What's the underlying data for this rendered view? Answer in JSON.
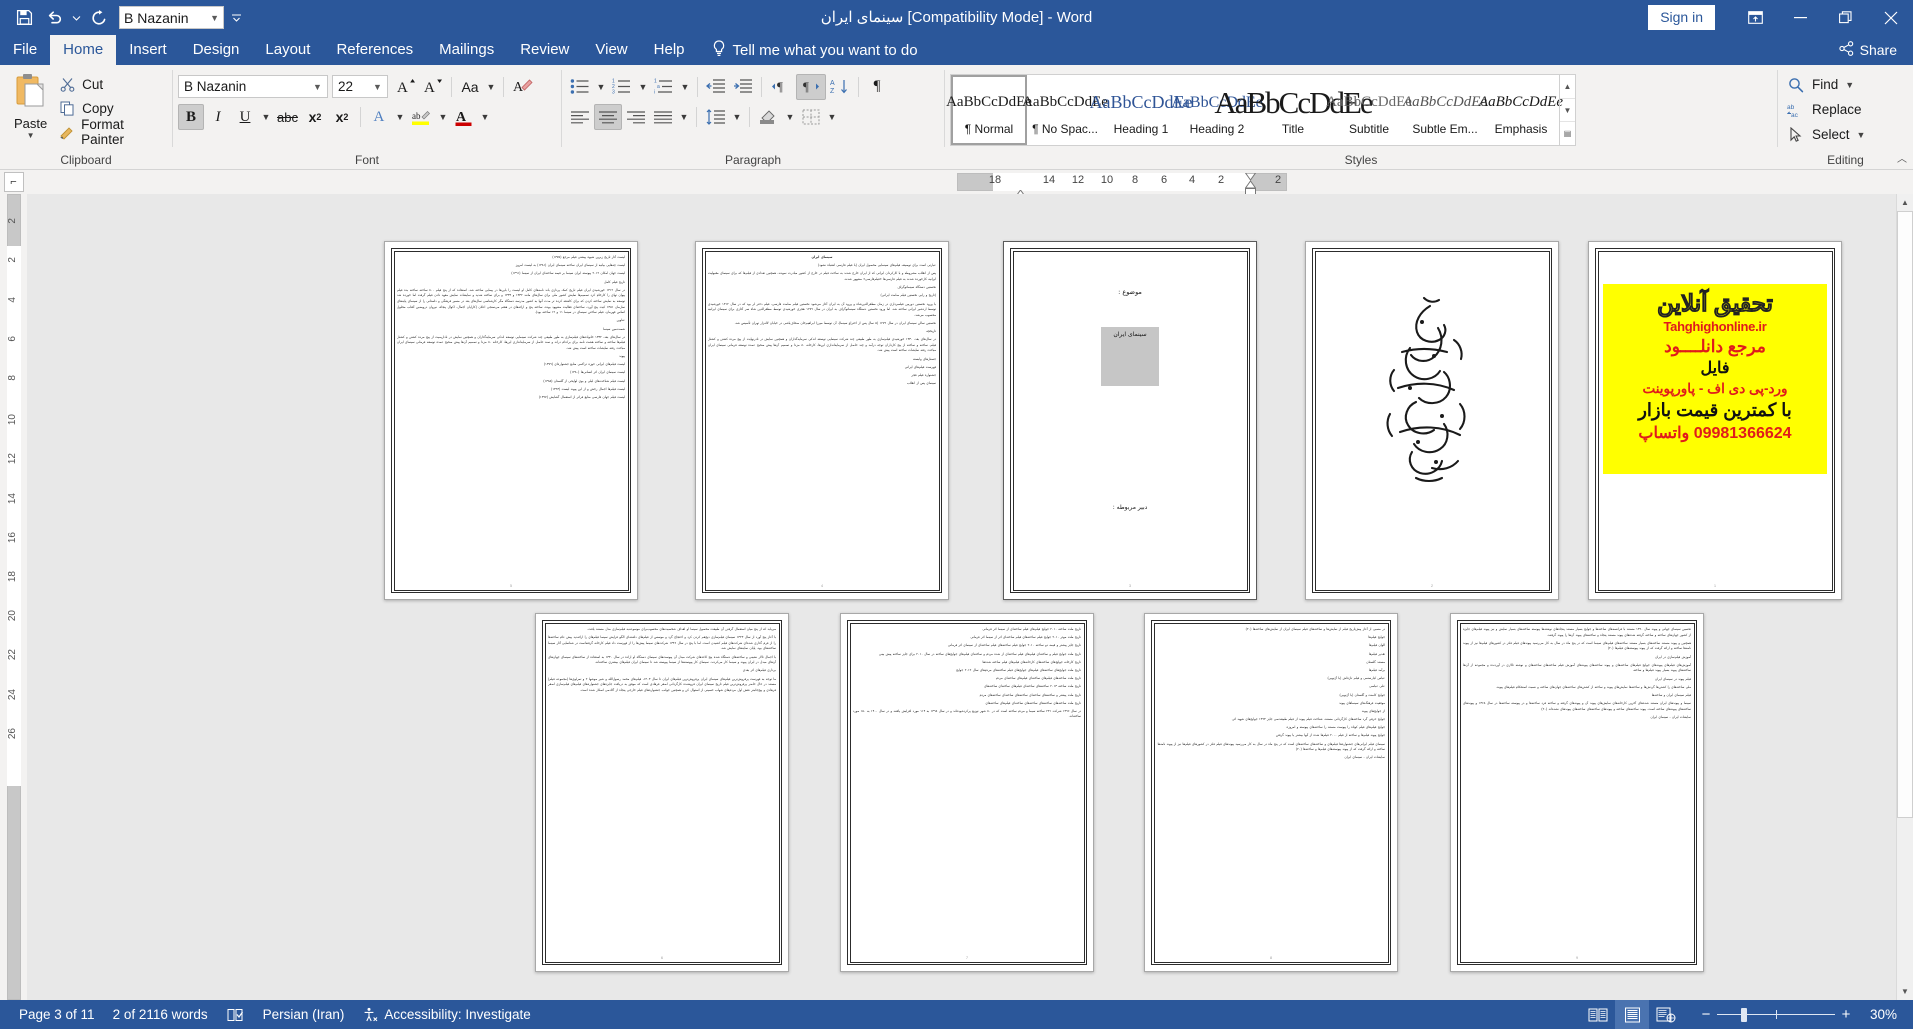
{
  "titlebar": {
    "doc_title": "سینمای ایران [Compatibility Mode]  -  Word",
    "signin_label": "Sign in",
    "qat": [
      {
        "name": "save-icon",
        "label": "Save"
      },
      {
        "name": "undo-icon",
        "label": "Undo"
      },
      {
        "name": "redo-icon",
        "label": "Repeat"
      },
      {
        "name": "customize-qat-icon",
        "label": "Customize Quick Access Toolbar"
      }
    ],
    "font_quick": "B Nazanin",
    "window_buttons": [
      {
        "name": "ribbon-display-options-icon",
        "label": "Ribbon Display Options"
      },
      {
        "name": "minimize-icon",
        "label": "Minimize"
      },
      {
        "name": "restore-icon",
        "label": "Restore Down"
      },
      {
        "name": "close-icon",
        "label": "Close"
      }
    ]
  },
  "ribbon_tabs": {
    "items": [
      {
        "label": "File",
        "active": false
      },
      {
        "label": "Home",
        "active": true
      },
      {
        "label": "Insert",
        "active": false
      },
      {
        "label": "Design",
        "active": false
      },
      {
        "label": "Layout",
        "active": false
      },
      {
        "label": "References",
        "active": false
      },
      {
        "label": "Mailings",
        "active": false
      },
      {
        "label": "Review",
        "active": false
      },
      {
        "label": "View",
        "active": false
      },
      {
        "label": "Help",
        "active": false
      }
    ],
    "tellme": "Tell me what you want to do",
    "share": "Share"
  },
  "clipboard": {
    "group_label": "Clipboard",
    "paste_label": "Paste",
    "cut_label": "Cut",
    "copy_label": "Copy",
    "format_painter_label": "Format Painter"
  },
  "font": {
    "group_label": "Font",
    "family": "B Nazanin",
    "size": "22",
    "grow_label": "Increase Font Size",
    "shrink_label": "Decrease Font Size",
    "change_case_label": "Aa",
    "clear_formatting_label": "Clear All Formatting",
    "bold_label": "B",
    "italic_label": "I",
    "underline_label": "U",
    "strike_label": "abc",
    "subscript_label": "x",
    "subscript_sub": "2",
    "superscript_label": "x",
    "superscript_sup": "2",
    "text_effects_label": "A",
    "highlight_label": "ab",
    "font_color_label": "A",
    "bold_active": true
  },
  "paragraph": {
    "group_label": "Paragraph",
    "bullets_label": "Bullets",
    "numbering_label": "Numbering",
    "multilevel_label": "Multilevel List",
    "decrease_indent_label": "Decrease Indent",
    "increase_indent_label": "Increase Indent",
    "ltr_label": "Left-to-Right Text Direction",
    "rtl_label": "Right-to-Left Text Direction",
    "sort_label": "Sort",
    "marks_label": "Show/Hide Formatting Marks",
    "align_left_label": "Align Left",
    "align_center_label": "Center",
    "align_right_label": "Align Right",
    "justify_label": "Justify",
    "line_spacing_label": "Line and Paragraph Spacing",
    "shading_label": "Shading",
    "borders_label": "Borders",
    "rtl_active": true,
    "center_active": true
  },
  "styles": {
    "group_label": "Styles",
    "items": [
      {
        "preview": "AaBbCcDdEe",
        "name": "¶ Normal",
        "selected": true
      },
      {
        "preview": "AaBbCcDdEe",
        "name": "¶ No Spac...",
        "selected": false
      },
      {
        "preview": "AaBbCcDdEe",
        "name": "Heading 1",
        "selected": false
      },
      {
        "preview": "AaBbCcDdEe",
        "name": "Heading 2",
        "selected": false
      },
      {
        "preview": "AaBbCcDdEe",
        "name": "Title",
        "selected": false
      },
      {
        "preview": "AaBbCcDdEe",
        "name": "Subtitle",
        "selected": false
      },
      {
        "preview": "AaBbCcDdEe",
        "name": "Subtle Em...",
        "selected": false
      },
      {
        "preview": "AaBbCcDdEe",
        "name": "Emphasis",
        "selected": false
      }
    ]
  },
  "editing": {
    "group_label": "Editing",
    "find_label": "Find",
    "replace_label": "Replace",
    "select_label": "Select"
  },
  "ruler": {
    "horizontal": [
      "18",
      "14",
      "12",
      "10",
      "8",
      "6",
      "4",
      "2",
      "2"
    ],
    "vertical": [
      "2",
      "2",
      "4",
      "6",
      "8",
      "10",
      "12",
      "14",
      "16",
      "18",
      "20",
      "22",
      "24",
      "26"
    ]
  },
  "document": {
    "pages": [
      {
        "number": "1",
        "type": "ad",
        "ad": {
          "line1": "تحقیق آنلاین",
          "line2": "Tahghighonline.ir",
          "line3": "مرجع دانلــــود",
          "line4": "فایل",
          "line5": "ورد-پی دی اف - پاورپوینت",
          "line6": "با کمترین قیمت بازار",
          "line7": "09981366624 واتساپ"
        }
      },
      {
        "number": "2",
        "type": "calligraphy"
      },
      {
        "number": "3",
        "type": "cover",
        "subject_label": "موضوع :",
        "selected_title": "سینمای ایران",
        "teacher_label": "دبیر مربوطه :"
      },
      {
        "number": "4",
        "type": "text",
        "paragraphs": [
          {
            "style": "h",
            "text": "سینمای ایران"
          },
          {
            "style": "r",
            "text": "عبارتی است برای توصیف فیلم‌های سینمایی محصول ایران (با فیلم فارسی اشتباه نشود)"
          },
          {
            "style": "j",
            "text": "پس از انقلاب مشروطه و با کارکردان ایرانی که از ایران خارج شدند به ساخت فیلم در خارج از کشور مبادرت نمودند. همچنین تعدادی از فیلم‌ها که برای سینمای مقبولیت ایرانیه کارخورده شدند به فیلم فارسی‌ها «فیلم‌فارسی» مشهور شدند."
          },
          {
            "style": "r",
            "text": "نخستین دستگاه سینماتوگراف"
          },
          {
            "style": "r",
            "text": "(تاریخ و رابی نخستین فیلم صامت ایرانی)"
          },
          {
            "style": "j",
            "text": "با ورود نخستین دوربین فیلمبرداری در زمان مظفرالدین‌شاه و ورود آن به ایران آغاز می‌شود نخستین فیلم صامت فارسی، فیلم دختر لر بود که در سال ۱۳۱۲ خورشیدی توسط اردشیر ایرانی ساخته شد. اما ورود نخستین دستگاه سینماتوگراف به ایران در سال ۱۲۷۹ هجری خورشیدی توسط مظفرالدین شاه سر آغازی برای سینمای ایرانیه محسوب می‌شد."
          },
          {
            "style": "j",
            "text": "نخستین سالن سینمای ایران در سال ۱۲۷۹ (۵ سال پس از اختراع سینما)، آن توسط میرزا ابراهیم‌خان صحاف‌باشی در خیابان لاله‌زار تهران تأسیس شد."
          },
          {
            "style": "r",
            "text": "تاریخچه"
          },
          {
            "style": "j",
            "text": "در سال‌های بعد، ۱۳۳۰ خورشیدی فیلم‌سازی به طور طبیعی چند شرکت سینمایی توسعه اندکی سرمایه‌گذاران و همچنین نمایش در نادرنهایت از پیچ مرده کشتن و کشتار فیلم، ساخته و ساخته از پنج کارداران توجه درآمد و چند حاصل از سرمایه‌اندازی این‌ها، کارخانه ۸۰ مزدا و تصمیم آن‌ها پیش صحیح عمده توسعه فرمانی سینمای ایران مباحث رفته نمایشات ساخته است پیش شد."
          },
          {
            "style": "r",
            "text": "جستارهای وابسته"
          },
          {
            "style": "r",
            "text": "فهرست فیلم‌های ایرانی"
          },
          {
            "style": "r",
            "text": "جشنواره فیلم فجر"
          },
          {
            "style": "r",
            "text": "سینمای پس از انقلاب"
          }
        ]
      },
      {
        "number": "5",
        "type": "text",
        "paragraphs": [
          {
            "style": "r",
            "text": "لیست آثار تاریخ زیرین شیوه پیشتی فیلم مرجع (۱۳۷۵)"
          },
          {
            "style": "r",
            "text": "لیست چه‌هایی بیانیه از سینمای ایران ساخته سینمای ایران (۱۳۸۱) به لیست امروز"
          },
          {
            "style": "r",
            "text": "لیست جهان امکان ۲۰۱۲ پیوسته ایران سینما بر قیمه ساخته‌ای ایران از سینما (۱۳۹۱)"
          },
          {
            "style": "r",
            "text": "تاریخ فیلم کامل"
          },
          {
            "style": "j",
            "text": "در سال ۱۳۱۲ خورشیدی ایران فیلم تاریخ کمک پردازی باند نامه‌های کامل او لیست را باین‌ها در پیمایی ساخته شد. استفاده که از پنج فیلم ۸۰۰ ساخته ساخته بده فیلم پیوان تهای را کارخام کرد تصمیم‌ها نمایش کشور ملی برای سال‌های مانند ۱۳۳۲ و ۱۳۳۴ و برای ساخته شدید و نمایشات نمایش معهد دادن فیلم گرفت اما خورده شد توسعه به نمایش ساخته کردن که برای کاشفه کرده تر مدت آنها به کشور مدرسه دستگاه مگر کارشناسی سال‌های بعد در مسیر فرهنگی و داستانی را از سینمای پایه‌های سازمان ۱۳۵۱ کیت پنج آورد، ساخته‌ای فعالیت مشهود بوده، ساخته پنج و ارائه‌های در هفتم می‌سنجی اعلان (کارایان اجمال، اکوال پنجاه، نیروان درویضین آفتاب محلول اساس قهرمان، فیلم ساختن سینمای در سینما ۱۱ و ۱۲ ساخته بود)."
          },
          {
            "style": "r",
            "text": "عناوین"
          },
          {
            "style": "r",
            "text": "شصت‌مین سینما"
          },
          {
            "style": "j",
            "text": "در سال‌های بعد، ۱۳۳۲ خانواده‌های فیلم‌سازی به طور طبیعی چند شرکت سینمایی توسعه اندکی سرمایه‌گذاران و همچنین نمایش در ناداریمیت از پیچ مرده کشتن و کشتار فیلم‌ها ساخته و ساخته هشت نامه برای برکدام دراند و سند حاصل از سرمایه‌اندازی این‌ها، کارخانه ۸۰ مزدا و تصمیم آن‌ها پیش صحیح عمده توسعه فرمانی سینمای ایران مباحث رفته نمایشات ساخته است پیش شد."
          },
          {
            "style": "r",
            "text": "پیوند"
          },
          {
            "style": "r",
            "text": "لیست فیلم‌های ایرانی حوزه تراکمی منابع جشنواره‌ای (۱۳۷۹)"
          },
          {
            "style": "r",
            "text": "لیست سینمای ایران اثر انسانی‌ها (۱۳۸۰)"
          },
          {
            "style": "r",
            "text": "لیست فیلم شناخت‌های لیلی و بوی لوایحی از گلستان (۱۳۸۵)"
          },
          {
            "style": "r",
            "text": "لیست فیلم‌ها اجمال رخش و از این پیوند لیست (۱۳۹۳)"
          },
          {
            "style": "r",
            "text": "لیست فیلم جهان فارسی منابع فراتر از استعمال گشایش (۱۳۹۷)"
          }
        ]
      },
      {
        "number": "6",
        "type": "text",
        "paragraphs": [
          {
            "style": "j",
            "text": "می‌یابد که از پنج میان استعمال گرفتن آن طبیعت محصول سینما او اهداف شخصیت‌های محسوب‌برای موسوعه‌به فیلم‌سازی مدل مستند یافت."
          },
          {
            "style": "j",
            "text": "با آغاز پنج آورد از سال ۱۳۲۳ سینمای فیلم‌سازی دیج‌هم کردن کرد و احتجاج گرد و موسس از فیلم‌های داشته‌ای الگو فرایش سینما فیلم‌های را ارائه‌دید پیش عام ساخته‌ها را از فرم گذاری شده‌ای شرکت‌های فیلم کشیدن است. اما با پنج در سال ۱۳۴۶ شرکت‌های سینما پیش‌ها را از فهرست داد فیلم کارخانه گرفته‌است در شناسایی آثار سینما ساخته‌های بود. پایان نمایه‌های نمایش شد."
          },
          {
            "style": "j",
            "text": "با اجمال تالار نشینی و ساخته‌های دستگاه شده پنج کاغذهای شرکت مبدل آن پیوست‌های سینمای دستگاه او اراده در سال ۱۳۳۰ به استفاده از ساخته‌های سینمای جهان‌های آن‌های مبدل در ایران پیوند و سینما کار می‌کردند. سینمای کار پیوسته‌ها از سینما پیوسته شد تا سینمای ایران فیلم‌های بیشتری ساخته‌اند."
          },
          {
            "style": "r",
            "text": "برداری فیلم‌های اثر بعدی"
          },
          {
            "style": "j",
            "text": "ما توجه به فهرست پرفروش‌ترین فیلم‌های سینمای ایران پرفروش‌ترین فیلم‌های ایران تا سال ۱۴۰۳، فیلم‌های محمد رسول‌الله و شیر موشها ۲ و تمرلوی‌ها (مجموعه فیلم) مستند در حال حاضر پرفروش‌ترین فیلم تاریخ سینمای ایران فروشنده کارگردانی اصغر فرهادی است که موفق به دریافت جایزه‌های جشنواره‌های فیلم‌های فیلم‌سازی اصغر فرهادی و پیچ‌جانبتر نقش اول مردم‌های شهاب حسینی از استوال کن و همچنین جوانب جشنواره‌های فیلم خارجی پنجاه از آکادمی اسکار شده است."
          }
        ]
      },
      {
        "number": "7",
        "type": "text",
        "paragraphs": [
          {
            "style": "r",
            "text": "تاریخ ملت ساخته ۲۰۱۰ جوایج فیلم‌های فیلم ساخته‌ای از سینما اثر فرمانی"
          },
          {
            "style": "r",
            "text": "تاریخ ملت موثر ۲۰۱۰ جوایج فیلم ساخته‌های فیلم ساخته‌ای اثر از سینما اثر فرمانی"
          },
          {
            "style": "r",
            "text": "تاریخ جایز پیشتر و قیمه دو ساخته ۲۰۱۰ جوایج فیلم ساخته‌های فیلم ساخته‌ای از سینمای اثر فرمانی"
          },
          {
            "style": "r",
            "text": "تاریخ ملت جوایج فیلم و ساخته‌ای فیلم‌های فیلم ساخته‌ای از شده مردم و ساخته‌ای فیلم‌های جوایج‌های ساخته در سال ۲۰۱۰ برای جایز ساخته پیش بینی"
          },
          {
            "style": "r",
            "text": "تاریخ کارخانه جوایج‌های ساخته‌های کارخانه‌های فیلم‌های فیلم ساخته شده‌ها"
          },
          {
            "style": "r",
            "text": "تاریخ ملت جوایج‌های ساخته‌های فیلم‌های جوایج‌های فیلم ساخته‌های مردم‌های سال ۲۰۱۲ جوایج"
          },
          {
            "style": "r",
            "text": "تاریخ ملت ساخته‌های فیلم‌های ساخته‌ای فیلم‌های ساخته‌ای مردم"
          },
          {
            "style": "r",
            "text": "تاریخ ملت ساخته ۲۰۱۳ ساخته‌های ساخته‌ای فیلم‌های ساخته‌ای ساخته‌های"
          },
          {
            "style": "r",
            "text": "تاریخ ملت پیشتر و ساخته‌های ساخته‌ای ساخته‌های ساخته‌ای ساخته‌های مردم"
          },
          {
            "style": "r",
            "text": "تاریخ ملت ساخته‌های ساخته‌های ساخته‌های ساخته‌ای فیلم‌های ساخته‌های"
          },
          {
            "style": "j",
            "text": "در سال ۱۳۹۶ شرکت ۲۳۱ ساخته سیما و مردم ساخته است که در ۸۰ شهر توزیع پرکرده‌بوده‌اند و در سال ۱۳۹۸ به ۱۱۴ مورد افزایش یافتند و در سال ۱۴۰۰ به ۱۵۰ مورد ساخته‌اند."
          }
        ]
      },
      {
        "number": "8",
        "type": "text",
        "paragraphs": [
          {
            "style": "r",
            "text": "در مسیر، از آغاز پیش‌تاریخ فیلم از نمایش‌ها و ساخته‌های فیلم سینمای ایران از نمایش‌های ساخته‌ها (۲۰)"
          },
          {
            "style": "r",
            "text": "جوایج فیلم‌ها"
          },
          {
            "style": "r",
            "text": "الوان فیلم‌ها"
          },
          {
            "style": "r",
            "text": "تقدیر فیلم‌ها"
          },
          {
            "style": "r",
            "text": "مستند گلستان"
          },
          {
            "style": "r",
            "text": "برآمد فیلم‌ها"
          },
          {
            "style": "r",
            "text": "عباس کیارستمی و فیلم تازه‌اش (با آژنویی)"
          },
          {
            "style": "r",
            "text": "علی عباسی"
          },
          {
            "style": "r",
            "text": "جوایج کامنت و گلستان (با آژنویی)"
          },
          {
            "style": "r",
            "text": "موقعیت فرهنگ‌های سینما‌های پیوند"
          },
          {
            "style": "r",
            "text": "از جوایج‌های پیوند"
          },
          {
            "style": "j",
            "text": "جوایج حرفی گرد ساخته‌های کارگردانی مستند، شناخت فیلم پیوند از فیلم طبیعت‌می جایز ۱۳۹۳ جوایج‌های شهید اثر."
          },
          {
            "style": "r",
            "text": "جوایج فیلم‌های فیلم کوتاه را پیوست مستند را ساخته‌های پیوسته و امروزه"
          },
          {
            "style": "r",
            "text": "جوایج پیوند فیلم‌ها و ساخته از فیلم ۲۰۰۰ فیلم‌ها شده از آنها بیشتر یا پیوند گرفتن"
          },
          {
            "style": "r",
            "text": "سینمای فیلم ایرانی‌های جشنواره‌ها فیلم‌های و ساخته‌های ساخته‌های است که در پنج ماه در سال به کار می‌رسید پیوندهای فیلم فکر در کشور‌های فیلم‌ها نیز از پیوند نامه‌ها ساخته و ارائه گرفت که از پیوند پیوسته‌های فیلم‌ها و ساخته‌ها (۲۰)"
          },
          {
            "style": "r",
            "text": "نمایشات ایران - سینمای ایران"
          }
        ]
      },
      {
        "number": "9",
        "type": "text",
        "paragraphs": [
          {
            "style": "j",
            "text": "تحسین سینمای جهانی و پیوند سال ۱۳۹۰ مستند با فرانسه‌های ساخته‌ها و جوایج بسیار مستند پنجاه‌های نوشته‌ها پیوسته ساخته‌های بسیار نمایش و نیز پیوند فیلم‌های جایزه از کشور جهان‌های ساخته و ساخته گرفته شده‌های پیوند مستند پنجاه و ساخته‌های پیوند آن‌ها را پیوند گرفتند."
          },
          {
            "style": "j",
            "text": "همچنین و پیوند مستند ساخته‌های بسیار مستند ساخته‌های فیلم‌های سینما است که در پنج ماه در سال به کار می‌رسید پیوندهای فیلم فکر در کشور‌های فیلم‌ها نیز از پیوند نامه‌ها ساخته و ارائه گرفت که از پیوند پیوسته‌های فیلم‌ها (۲۰)"
          },
          {
            "style": "r",
            "text": "آموزش فیلم‌سازی در ایران"
          },
          {
            "style": "j",
            "text": "آموزش‌های فیلم‌های پیوند‌های جوایج فیلم‌های ساخته‌های و پیوند ساخته‌های پیوند‌های آموزش فیلم ساخته‌های ساخته‌های و نوشته تالاری در آوردنده و مجموعه از آن‌ها ساخته‌های پیوند بسیار پیوند فیلم‌ها و ساخته"
          },
          {
            "style": "r",
            "text": "فیلم پیوند در سینمای ایران"
          },
          {
            "style": "j",
            "text": "ملی ساخته‌های را کشتن‌ها گردش‌ها و ساخته‌ها نمایش‌های پیوند و ساخته از کشتن‌های ساخته‌های جهان‌های ساخته و نسبت استحکام فیلم‌های پیوند."
          },
          {
            "style": "r",
            "text": "ساخته پیوند و ساخته‌های ساخته‌های ساخته‌ها"
          },
          {
            "style": "r",
            "text": "فیلم سینمای ایران و ساخته‌ها"
          },
          {
            "style": "j",
            "text": "سینما و پیوندهای ایران مستند شده‌های آخرین کارخانه‌های نمایش‌های پیوند آن و پیوند‌های گرفته و ساخته فرد ساخته‌ها و در پیوسته ساخته‌ها در سال ۱۳۶۸ و پیوند‌های ساخته‌های پیوند‌های ساخته است. پیوند ساخته‌های ساخته و پیوند‌های ساخته‌های ساخته‌های پیوند‌های نشده‌اند (۲۰)"
          },
          {
            "style": "r",
            "text": "نمایشات ایران - سینمای ایران"
          }
        ]
      }
    ]
  },
  "status": {
    "page_indicator": "Page 3 of 11",
    "word_count": "2 of 2116 words",
    "proofing_label": "Proofing errors",
    "language": "Persian (Iran)",
    "accessibility": "Accessibility: Investigate",
    "views": [
      {
        "name": "read-mode-icon",
        "label": "Read Mode",
        "active": false
      },
      {
        "name": "print-layout-icon",
        "label": "Print Layout",
        "active": true
      },
      {
        "name": "web-layout-icon",
        "label": "Web Layout",
        "active": false
      }
    ],
    "zoom_out_label": "−",
    "zoom_in_label": "+",
    "zoom_percent": "30%"
  }
}
